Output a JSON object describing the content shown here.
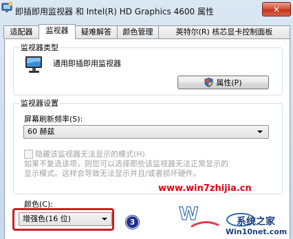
{
  "window": {
    "title": "即插即用监视器 和 Intel(R) HD Graphics 4600 属性",
    "close_glyph": "✕"
  },
  "tabs": [
    {
      "label": "适配器"
    },
    {
      "label": "监视器"
    },
    {
      "label": "疑难解答"
    },
    {
      "label": "颜色管理"
    },
    {
      "label": "英特尔(R) 核芯显卡控制面板"
    }
  ],
  "monitor_type": {
    "group_label": "监视器类型",
    "monitor_name": "通用即插即用监视器",
    "properties_button": "属性(P)"
  },
  "monitor_settings": {
    "group_label": "监视器设置",
    "refresh_label": "屏幕刷新频率(S):",
    "refresh_value": "60 赫兹",
    "hide_modes_label": "隐藏该监视器无法显示的模式(H)",
    "help_line1": "如果不复选该项，则您可以选择那些该监视器无法正常显示的",
    "help_line2": "显示模式。这样会导致无法显示并且/或者损坏硬件。"
  },
  "colors": {
    "label": "颜色(C):",
    "value": "增强色(16 位)"
  },
  "annotation": {
    "step": "3"
  },
  "watermark": {
    "url": "www.win7zhijia.cn",
    "brand": "系统之家",
    "site": "Win10net.com"
  }
}
